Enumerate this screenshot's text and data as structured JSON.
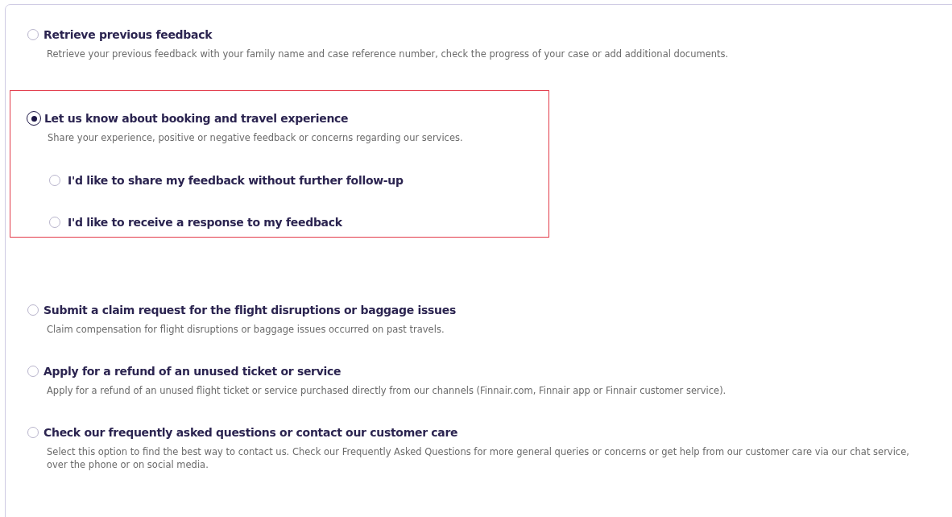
{
  "options": [
    {
      "title": "Retrieve previous feedback",
      "description": "Retrieve your previous feedback with your family name and case reference number, check the progress of your case or add additional documents.",
      "selected": false,
      "highlighted": false
    },
    {
      "title": "Let us know about booking and travel experience",
      "description": "Share your experience, positive or negative feedback or concerns regarding our services.",
      "selected": true,
      "highlighted": true,
      "children": [
        {
          "label": "I'd like to share my feedback without further follow-up",
          "selected": false
        },
        {
          "label": "I'd like to receive a response to my feedback",
          "selected": false
        }
      ]
    },
    {
      "title": "Submit a claim request for the flight disruptions or baggage issues",
      "description": "Claim compensation for flight disruptions or baggage issues occurred on past travels.",
      "selected": false,
      "highlighted": false
    },
    {
      "title": "Apply for a refund of an unused ticket or service",
      "description": "Apply for a refund of an unused flight ticket or service purchased directly from our channels (Finnair.com, Finnair app or Finnair customer service).",
      "selected": false,
      "highlighted": false
    },
    {
      "title": "Check our frequently asked questions or contact our customer care",
      "description": "Select this option to find the best way to contact us. Check our Frequently Asked Questions for more general queries or concerns or get help from our customer care via our chat service, over the phone or on social media.",
      "selected": false,
      "highlighted": false
    }
  ]
}
